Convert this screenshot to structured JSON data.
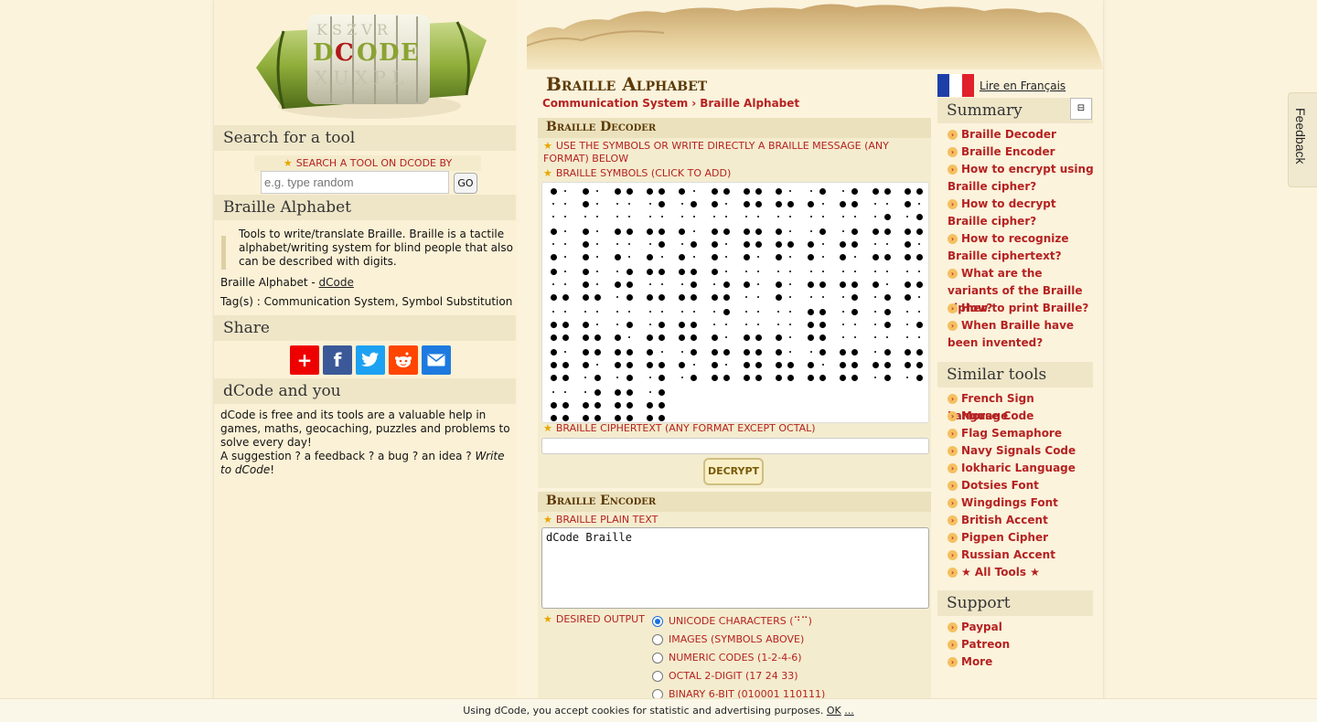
{
  "logo": {
    "brand_text": "DCODE"
  },
  "left": {
    "search_header": "Search for a tool",
    "search_label": "SEARCH A TOOL ON DCODE BY KEYWORDS:",
    "search_placeholder": "e.g. type random",
    "search_button": "GO",
    "tool_header": "Braille Alphabet",
    "tool_desc": "Tools to write/translate Braille. Braille is a tactile alphabet/writing system for blind people that also can be described with digits.",
    "credit_prefix": "Braille Alphabet - ",
    "credit_link": "dCode",
    "tags": "Tag(s) : Communication System, Symbol Substitution",
    "share_header": "Share",
    "share_buttons": [
      "add-icon",
      "facebook-icon",
      "twitter-icon",
      "reddit-icon",
      "email-icon"
    ],
    "you_header": "dCode and you",
    "you_text1": "dCode is free and its tools are a valuable help in games, maths, geocaching, puzzles and problems to solve every day!",
    "you_text2": "A suggestion ? a feedback ? a bug ? an idea ? ",
    "you_link": "Write to dCode",
    "you_end": "!"
  },
  "center": {
    "page_title": "Braille Alphabet",
    "breadcrumb": [
      "Communication System",
      "Braille Alphabet"
    ],
    "breadcrumb_sep": "›",
    "decoder": {
      "title": "Braille Decoder",
      "label_symbols_info": "USE THE SYMBOLS OR WRITE DIRECTLY A BRAILLE MESSAGE (ANY FORMAT) BELOW",
      "label_click": "BRAILLE SYMBOLS (CLICK TO ADD)",
      "label_cipher": "BRAILLE CIPHERTEXT (ANY FORMAT EXCEPT OCTAL)",
      "decrypt_button": "DECRYPT",
      "cells": [
        [
          0,
          [
            1
          ]
        ],
        [
          1,
          [
            1,
            2
          ]
        ],
        [
          2,
          [
            1,
            4
          ]
        ],
        [
          3,
          [
            1,
            4,
            5
          ]
        ],
        [
          4,
          [
            1,
            5
          ]
        ],
        [
          5,
          [
            1,
            2,
            4
          ]
        ],
        [
          6,
          [
            1,
            2,
            4,
            5
          ]
        ],
        [
          7,
          [
            1,
            2,
            5
          ]
        ],
        [
          8,
          [
            2,
            4
          ]
        ],
        [
          9,
          [
            2,
            4,
            5
          ]
        ],
        [
          10,
          [
            1,
            4,
            6
          ]
        ],
        [
          11,
          [
            1,
            2,
            4,
            6
          ]
        ],
        [
          12,
          [
            1,
            3
          ]
        ],
        [
          13,
          [
            1,
            2,
            3
          ]
        ],
        [
          14,
          [
            1,
            3,
            4
          ]
        ],
        [
          15,
          [
            1,
            3,
            4,
            5
          ]
        ],
        [
          16,
          [
            1,
            3,
            5
          ]
        ],
        [
          17,
          [
            1,
            2,
            3,
            4
          ]
        ],
        [
          18,
          [
            1,
            2,
            3,
            4,
            5
          ]
        ],
        [
          19,
          [
            1,
            2,
            3,
            5
          ]
        ],
        [
          20,
          [
            2,
            3,
            4
          ]
        ],
        [
          21,
          [
            2,
            3,
            4,
            5
          ]
        ],
        [
          22,
          [
            1,
            3,
            4,
            6
          ]
        ],
        [
          23,
          [
            1,
            2,
            3,
            4,
            6
          ]
        ],
        [
          24,
          [
            1,
            3,
            6
          ]
        ],
        [
          25,
          [
            1,
            2,
            3,
            6
          ]
        ],
        [
          26,
          [
            2,
            4,
            5,
            6
          ]
        ],
        [
          27,
          [
            1,
            3,
            4,
            6
          ]
        ],
        [
          28,
          [
            1,
            3,
            4,
            5,
            6
          ]
        ],
        [
          29,
          [
            1,
            3,
            5,
            6
          ]
        ],
        [
          30,
          [
            2
          ]
        ],
        [
          31,
          [
            2,
            3
          ]
        ],
        [
          32,
          [
            2,
            5
          ]
        ],
        [
          33,
          [
            2,
            5,
            6
          ]
        ],
        [
          34,
          [
            2,
            6
          ]
        ],
        [
          35,
          [
            2,
            3,
            5
          ]
        ],
        [
          36,
          [
            2,
            3,
            5,
            6
          ]
        ],
        [
          37,
          [
            2,
            3,
            6
          ]
        ],
        [
          38,
          [
            3,
            5
          ]
        ],
        [
          39,
          [
            3,
            5,
            6
          ]
        ],
        [
          40,
          [
            2,
            3,
            5,
            6
          ]
        ],
        [
          41,
          [
            3,
            4
          ]
        ],
        [
          42,
          [
            3,
            6
          ]
        ],
        [
          43,
          [
            3
          ]
        ],
        [
          44,
          [
            1,
            2,
            3,
            4,
            5,
            6
          ]
        ],
        [
          45,
          [
            4
          ]
        ],
        [
          46,
          [
            4,
            5
          ]
        ],
        [
          47,
          [
            5
          ]
        ],
        [
          48,
          [
            1,
            2,
            3,
            5,
            6
          ]
        ],
        [
          49,
          [
            1,
            2,
            4,
            6
          ]
        ],
        [
          50,
          [
            1,
            2,
            4,
            5,
            6
          ]
        ],
        [
          51,
          [
            1,
            2,
            5,
            6
          ]
        ],
        [
          52,
          [
            2,
            4,
            6
          ]
        ],
        [
          53,
          [
            1,
            2,
            3,
            4,
            6
          ]
        ],
        [
          54,
          [
            1,
            2,
            3,
            4,
            5,
            6
          ]
        ],
        [
          55,
          [
            1,
            2,
            3,
            5,
            6
          ]
        ],
        [
          56,
          [
            2,
            3,
            4,
            6
          ]
        ],
        [
          57,
          [
            1,
            2,
            3,
            4,
            5,
            6
          ]
        ],
        [
          58,
          [
            2,
            4,
            5,
            6
          ]
        ],
        [
          59,
          [
            1,
            2,
            4,
            5,
            6
          ]
        ],
        [
          60,
          [
            2,
            3,
            5,
            6
          ]
        ],
        [
          61,
          [
            2,
            3,
            4,
            5,
            6
          ]
        ],
        [
          62,
          [
            1,
            2,
            3,
            4,
            5,
            6
          ]
        ],
        [
          63,
          [
            2,
            3,
            4,
            5,
            6
          ]
        ]
      ]
    },
    "encoder": {
      "title": "Braille Encoder",
      "label_plain": "BRAILLE PLAIN TEXT",
      "plain_value": "dCode Braille",
      "label_output": "DESIRED OUTPUT",
      "options": [
        "UNICODE CHARACTERS (⠙⠉)",
        "IMAGES (SYMBOLS ABOVE)",
        "NUMERIC CODES (1-2-4-6)",
        "OCTAL 2-DIGIT (17 24 33)",
        "BINARY 6-BIT (010001 110111)"
      ],
      "selected_index": 0
    }
  },
  "right": {
    "lang_link": "Lire en Français",
    "summary_header": "Summary",
    "summary_items": [
      "Braille Decoder",
      "Braille Encoder",
      "How to encrypt using Braille cipher?",
      "How to decrypt Braille cipher?",
      "How to recognize Braille ciphertext?",
      "What are the variants of the Braille cipher?",
      "How to print Braille?",
      "When Braille have been invented?"
    ],
    "similar_header": "Similar tools",
    "similar_items": [
      "French Sign Language",
      "Morse Code",
      "Flag Semaphore",
      "Navy Signals Code",
      "Iokharic Language",
      "Dotsies Font",
      "Wingdings Font",
      "British Accent",
      "Pigpen Cipher",
      "Russian Accent",
      "★ All Tools ★"
    ],
    "support_header": "Support",
    "support_items": [
      "Paypal",
      "Patreon",
      "More"
    ]
  },
  "feedback_tab": "Feedback",
  "cookie": {
    "text": "Using dCode, you accept cookies for statistic and advertising purposes. ",
    "ok": "OK",
    "more": "..."
  },
  "colors": {
    "page_bg": "#fbf3dc",
    "header_bg": "#efe6c8",
    "link_red": "#b52222",
    "title_brown": "#5c3a08"
  }
}
